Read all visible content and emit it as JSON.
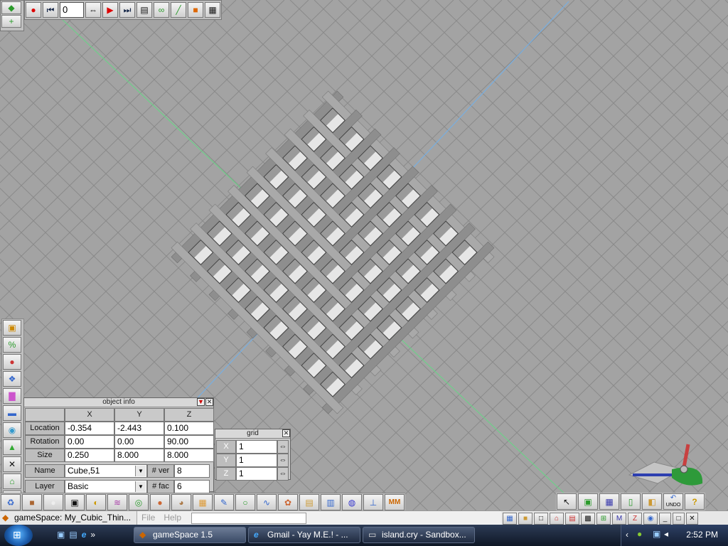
{
  "toolbar": {
    "frame_value": "0"
  },
  "object_info": {
    "title": "object info",
    "columns": [
      "X",
      "Y",
      "Z"
    ],
    "location_label": "Location",
    "location": [
      "-0.354",
      "-2.443",
      "0.100"
    ],
    "rotation_label": "Rotation",
    "rotation": [
      "0.00",
      "0.00",
      "90.00"
    ],
    "size_label": "Size",
    "size": [
      "0.250",
      "8.000",
      "8.000"
    ],
    "name_label": "Name",
    "name_value": "Cube,51",
    "ver_label": "# ver",
    "ver_value": "8",
    "layer_label": "Layer",
    "layer_value": "Basic",
    "fac_label": "# fac",
    "fac_value": "6"
  },
  "grid_panel": {
    "title": "grid",
    "x_label": "X",
    "x_value": "1",
    "y_label": "Y",
    "y_value": "1",
    "z_label": "Z",
    "z_value": "1"
  },
  "undo_label": "UNDO",
  "app": {
    "title": "gameSpace: My_Cubic_Thin...",
    "menu_file": "File",
    "menu_help": "Help"
  },
  "taskbar": {
    "quicklaunch_more": "»",
    "tasks": [
      "gameSpace 1.5",
      "Gmail - Yay M.E.! - ...",
      "island.cry - Sandbox..."
    ],
    "clock": "2:52 PM"
  },
  "colors": {
    "viewport_bg": "#a3a3a3",
    "grid_line": "#8a8a8a",
    "x_axis": "#6fcf8a",
    "y_axis": "#78aee0"
  }
}
